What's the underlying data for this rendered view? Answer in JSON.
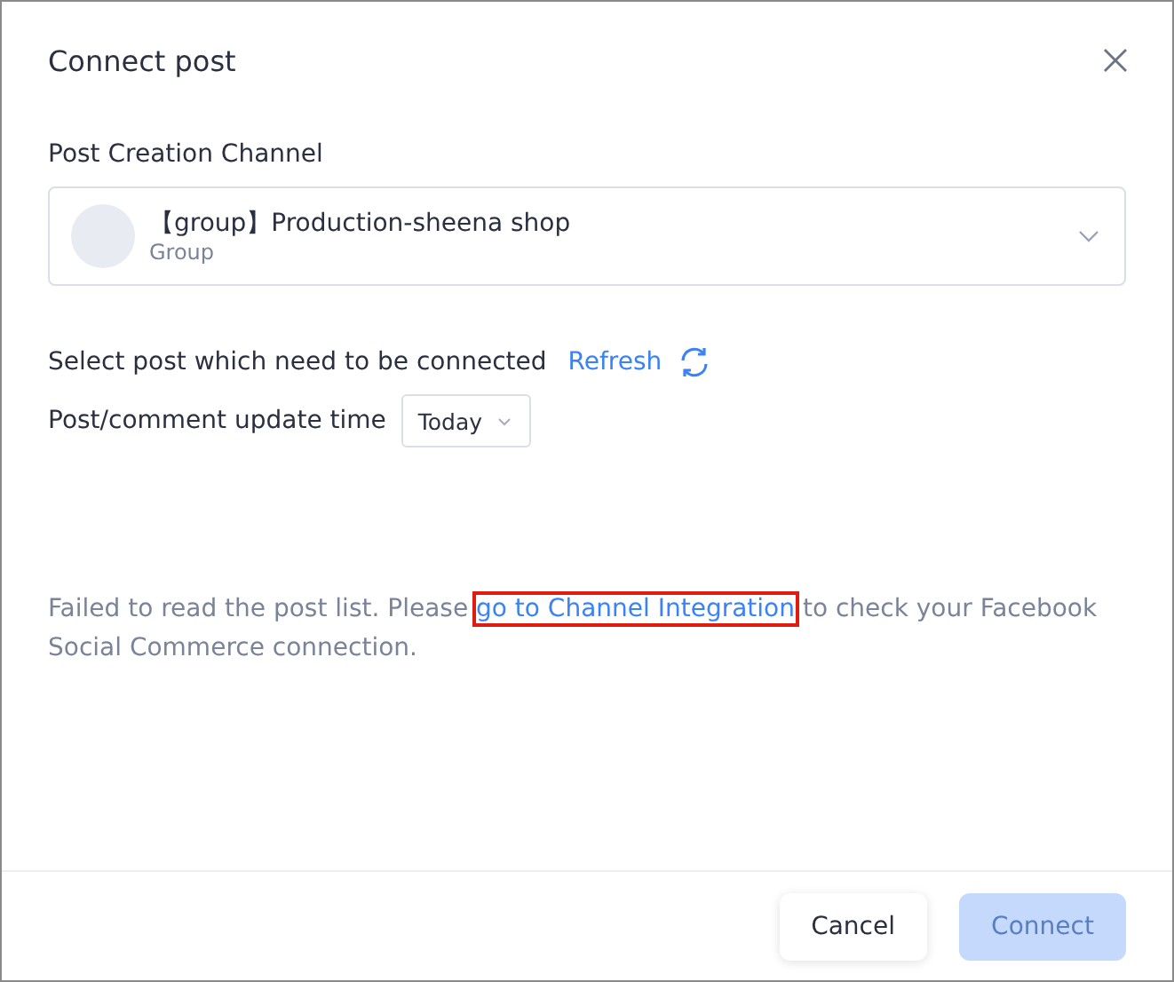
{
  "dialog": {
    "title": "Connect post"
  },
  "channel": {
    "label": "Post Creation Channel",
    "name": "【group】Production-sheena shop",
    "type": "Group"
  },
  "select_post": {
    "label": "Select post which need to be connected",
    "refresh": "Refresh"
  },
  "update_time": {
    "label": "Post/comment update time",
    "value": "Today"
  },
  "message": {
    "before": "Failed to read the post list. Please ",
    "link": "go to Channel Integration",
    "link_highlighted": true,
    "after": " to check your Facebook Social Commerce connection."
  },
  "buttons": [
    {
      "label": "Cancel",
      "kind": "secondary",
      "disabled": false
    },
    {
      "label": "Connect",
      "kind": "primary",
      "disabled": true
    }
  ]
}
